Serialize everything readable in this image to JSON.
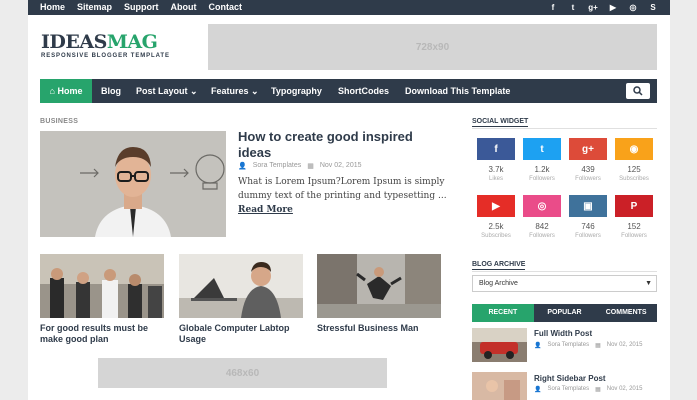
{
  "topnav": [
    "Home",
    "Sitemap",
    "Support",
    "About",
    "Contact"
  ],
  "top_social_icons": [
    "facebook-icon",
    "twitter-icon",
    "google-plus-icon",
    "youtube-icon",
    "dribbble-icon",
    "skype-icon"
  ],
  "top_social_glyphs": [
    "f",
    "t",
    "g+",
    "▶",
    "◎",
    "S"
  ],
  "logo": {
    "part1": "IDEAS",
    "part2": "MAG",
    "tagline": "RESPONSIVE BLOGGER TEMPLATE"
  },
  "ad_top": "728x90",
  "mainnav": {
    "home": "Home",
    "items": [
      "Blog",
      "Post Layout",
      "Features",
      "Typography",
      "ShortCodes",
      "Download This Template"
    ]
  },
  "section_label": "BUSINESS",
  "featured": {
    "title": "How to create good inspired ideas",
    "author": "Sora Templates",
    "date": "Nov 02, 2015",
    "desc": "What is Lorem Ipsum?Lorem Ipsum is simply dummy text of the printing and typesetting ...",
    "read_more": "Read More"
  },
  "posts": [
    {
      "title": "For good results must be make good plan"
    },
    {
      "title": "Globale Computer Labtop Usage"
    },
    {
      "title": "Stressful Business Man"
    }
  ],
  "ad_bottom": "468x60",
  "social_widget": {
    "title": "SOCIAL WIDGET",
    "items": [
      {
        "icon": "facebook-icon",
        "glyph": "f",
        "count": "3.7k",
        "label": "Likes",
        "color": "#3b5998"
      },
      {
        "icon": "twitter-icon",
        "glyph": "t",
        "count": "1.2k",
        "label": "Followers",
        "color": "#1da1f2"
      },
      {
        "icon": "google-plus-icon",
        "glyph": "g+",
        "count": "439",
        "label": "Followers",
        "color": "#dd4b39"
      },
      {
        "icon": "rss-icon",
        "glyph": "◉",
        "count": "125",
        "label": "Subscribes",
        "color": "#f9a21a"
      },
      {
        "icon": "youtube-icon",
        "glyph": "▶",
        "count": "2.5k",
        "label": "Subscribes",
        "color": "#e52d27"
      },
      {
        "icon": "dribbble-icon",
        "glyph": "◎",
        "count": "842",
        "label": "Followers",
        "color": "#ea4c89"
      },
      {
        "icon": "instagram-icon",
        "glyph": "▣",
        "count": "746",
        "label": "Followers",
        "color": "#3f729b"
      },
      {
        "icon": "pinterest-icon",
        "glyph": "P",
        "count": "152",
        "label": "Followers",
        "color": "#cb2027"
      }
    ]
  },
  "blog_archive": {
    "title": "BLOG ARCHIVE",
    "value": "Blog Archive"
  },
  "tabs": [
    "RECENT",
    "POPULAR",
    "COMMENTS"
  ],
  "recent": [
    {
      "title": "Full Width Post",
      "author": "Sora Templates",
      "date": "Nov 02, 2015"
    },
    {
      "title": "Right Sidebar Post",
      "author": "Sora Templates",
      "date": "Nov 02, 2015"
    }
  ],
  "colors": {
    "dark": "#2f3b4a",
    "green": "#27a46c"
  }
}
